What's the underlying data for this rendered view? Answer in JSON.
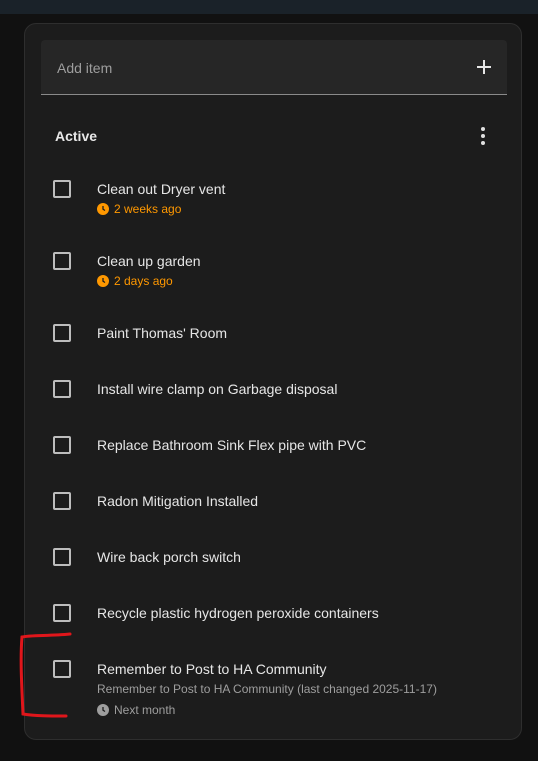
{
  "add_item": {
    "placeholder": "Add item",
    "button_icon": "plus-icon"
  },
  "section": {
    "title": "Active",
    "menu_icon": "more-vertical-icon"
  },
  "items": [
    {
      "label": "Clean out Dryer vent",
      "due": "2 weeks ago",
      "due_status": "overdue"
    },
    {
      "label": "Clean up garden",
      "due": "2 days ago",
      "due_status": "overdue"
    },
    {
      "label": "Paint Thomas' Room"
    },
    {
      "label": "Install wire clamp on Garbage disposal"
    },
    {
      "label": "Replace Bathroom Sink Flex pipe with PVC"
    },
    {
      "label": "Radon Mitigation Installed"
    },
    {
      "label": "Wire back porch switch"
    },
    {
      "label": "Recycle plastic hydrogen peroxide containers"
    },
    {
      "label": "Remember to Post to HA Community",
      "description": "Remember to Post to HA Community (last changed 2025-11-17)",
      "due": "Next month",
      "due_status": "future"
    }
  ],
  "colors": {
    "overdue": "#ff9800",
    "future": "#9e9e9e",
    "annotation": "#e0161b"
  }
}
